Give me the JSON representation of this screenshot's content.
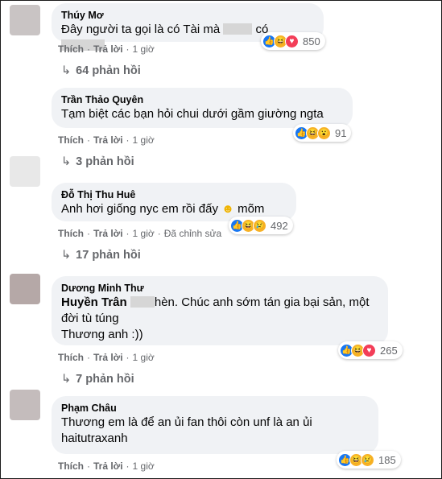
{
  "comments": [
    {
      "author": "Thúy Mơ",
      "text_before": "Đây người ta gọi là có Tài mà",
      "text_mid": "có",
      "like_label": "Thích",
      "reply_label": "Trả lời",
      "time": "1 giờ",
      "reaction_count": "850",
      "reactions": [
        "like",
        "haha",
        "love"
      ],
      "replies": "64 phản hồi"
    },
    {
      "author": "Trần Thảo Quyên",
      "text": "Tạm biệt các bạn hỏi chui dưới gầm giường ngta",
      "like_label": "Thích",
      "reply_label": "Trả lời",
      "time": "1 giờ",
      "reaction_count": "91",
      "reactions": [
        "like",
        "haha",
        "wow"
      ],
      "replies": "3 phản hồi"
    },
    {
      "author": "Đỗ Thị Thu Huê",
      "text": "Anh hơi giống nyc em rồi đấy",
      "emoji": "☻",
      "text_after": "mõm",
      "like_label": "Thích",
      "reply_label": "Trả lời",
      "time": "1 giờ",
      "edited": "Đã chỉnh sửa",
      "reaction_count": "492",
      "reactions": [
        "like",
        "haha",
        "sad"
      ],
      "replies": "17 phản hồi"
    },
    {
      "author": "Dương Minh Thư",
      "mention": "Huyền Trân",
      "text_line1": "hèn. Chúc anh sớm tán gia bại sản, một",
      "text_line2": "đời tù túng",
      "text_line3": "Thương anh :))",
      "like_label": "Thích",
      "reply_label": "Trả lời",
      "time": "1 giờ",
      "reaction_count": "265",
      "reactions": [
        "like",
        "haha",
        "love"
      ],
      "replies": "7 phản hồi"
    },
    {
      "author": "Phạm Châu",
      "text_line1": "Thương em là để an ủi fan thôi còn unf là an ủi",
      "text_line2": "haitutraxanh",
      "like_label": "Thích",
      "reply_label": "Trả lời",
      "time": "1 giờ",
      "reaction_count": "185",
      "reactions": [
        "like",
        "haha",
        "sad"
      ]
    }
  ],
  "colors": {
    "bubble": "#f0f2f5",
    "meta": "#65676b",
    "like": "#1877f2",
    "haha": "#f7b125",
    "love": "#f33e58"
  },
  "icons": {
    "reply_arrow": "↳",
    "like": "👍",
    "haha": "😆",
    "love": "♥",
    "sad": "😢",
    "wow": "😮"
  }
}
